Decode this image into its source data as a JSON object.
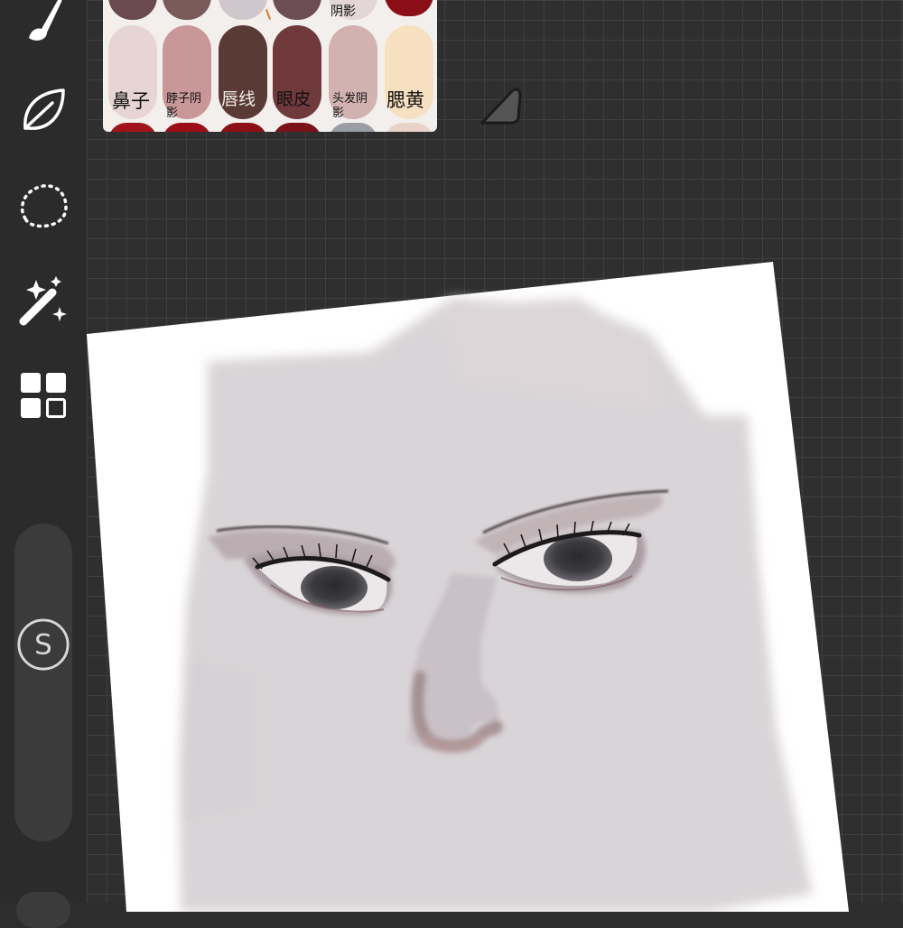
{
  "toolbar": {
    "tools": [
      {
        "name": "brush",
        "icon": "brush-icon"
      },
      {
        "name": "smudge",
        "icon": "leaf-icon"
      },
      {
        "name": "selection",
        "icon": "selection-lasso-icon"
      },
      {
        "name": "adjustments",
        "icon": "magic-wand-icon"
      },
      {
        "name": "layers",
        "icon": "layers-grid-icon"
      }
    ],
    "modifier_symbol": "S"
  },
  "palette": {
    "top_row_labels": [
      "阴影"
    ],
    "labels": [
      {
        "text": "鼻子"
      },
      {
        "text": "脖子阴",
        "sub": "影"
      },
      {
        "text": "唇线"
      },
      {
        "text": "眼皮"
      },
      {
        "text": "头发阴",
        "sub": "影"
      },
      {
        "text": "腮黄"
      }
    ],
    "colors": {
      "nose": "#e6d5d2",
      "neck_shadow": "#c99798",
      "lip_line": "#5a3a34",
      "eyelid": "#703a3d",
      "hair_shadow": "#d2b2b0",
      "blush": "#f7e0bf",
      "accent_red": "#8b0f16"
    }
  },
  "canvas": {
    "background": "#ffffff",
    "skin": "#d8d3d6"
  }
}
